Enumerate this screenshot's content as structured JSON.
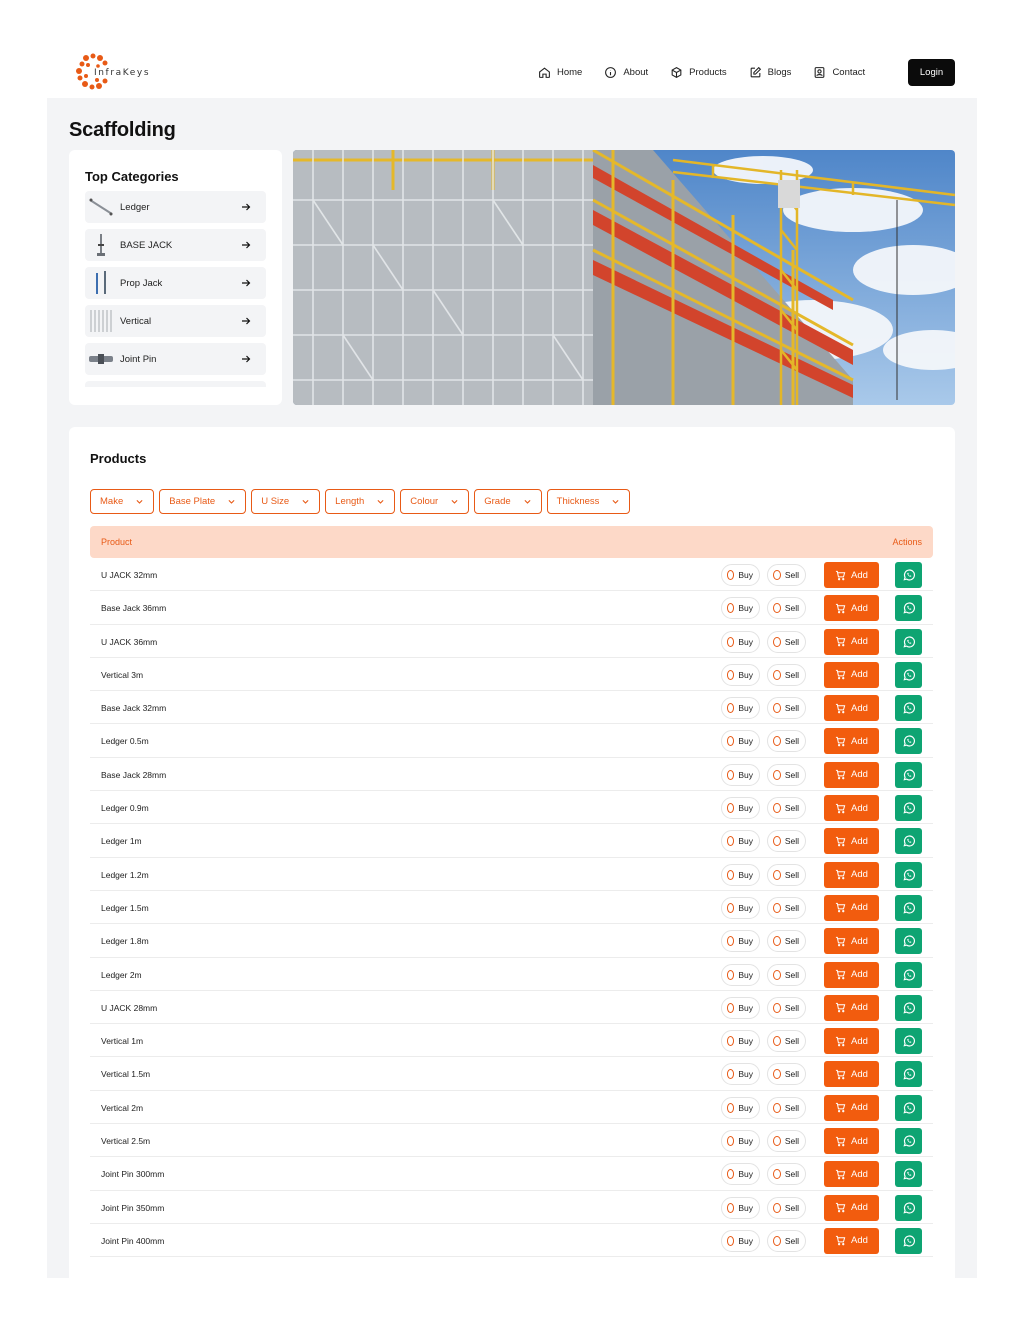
{
  "brand": {
    "logo_text": "InfraKeys"
  },
  "nav": {
    "items": [
      {
        "label": "Home",
        "icon": "home-icon"
      },
      {
        "label": "About",
        "icon": "info-icon"
      },
      {
        "label": "Products",
        "icon": "box-icon"
      },
      {
        "label": "Blogs",
        "icon": "edit-icon"
      },
      {
        "label": "Contact",
        "icon": "contact-icon"
      }
    ],
    "login_label": "Login"
  },
  "page": {
    "title": "Scaffolding"
  },
  "categories": {
    "title": "Top Categories",
    "items": [
      {
        "label": "Ledger"
      },
      {
        "label": "BASE JACK"
      },
      {
        "label": "Prop Jack"
      },
      {
        "label": "Vertical"
      },
      {
        "label": "Joint Pin"
      }
    ]
  },
  "products": {
    "title": "Products",
    "filters": [
      "Make",
      "Base Plate",
      "U Size",
      "Length",
      "Colour",
      "Grade",
      "Thickness"
    ],
    "columns": {
      "product": "Product",
      "actions": "Actions"
    },
    "buy_label": "Buy",
    "sell_label": "Sell",
    "add_label": "Add",
    "rows": [
      "U JACK 32mm",
      "Base Jack 36mm",
      "U JACK 36mm",
      "Vertical 3m",
      "Base Jack 32mm",
      "Ledger 0.5m",
      "Base Jack 28mm",
      "Ledger 0.9m",
      "Ledger 1m",
      "Ledger 1.2m",
      "Ledger 1.5m",
      "Ledger 1.8m",
      "Ledger 2m",
      "U JACK 28mm",
      "Vertical 1m",
      "Vertical 1.5m",
      "Vertical 2m",
      "Vertical 2.5m",
      "Joint Pin 300mm",
      "Joint Pin 350mm",
      "Joint Pin 400mm"
    ]
  },
  "colors": {
    "accent": "#f25c0e",
    "whatsapp": "#0ea472",
    "header_bg": "#fdd9c8"
  }
}
